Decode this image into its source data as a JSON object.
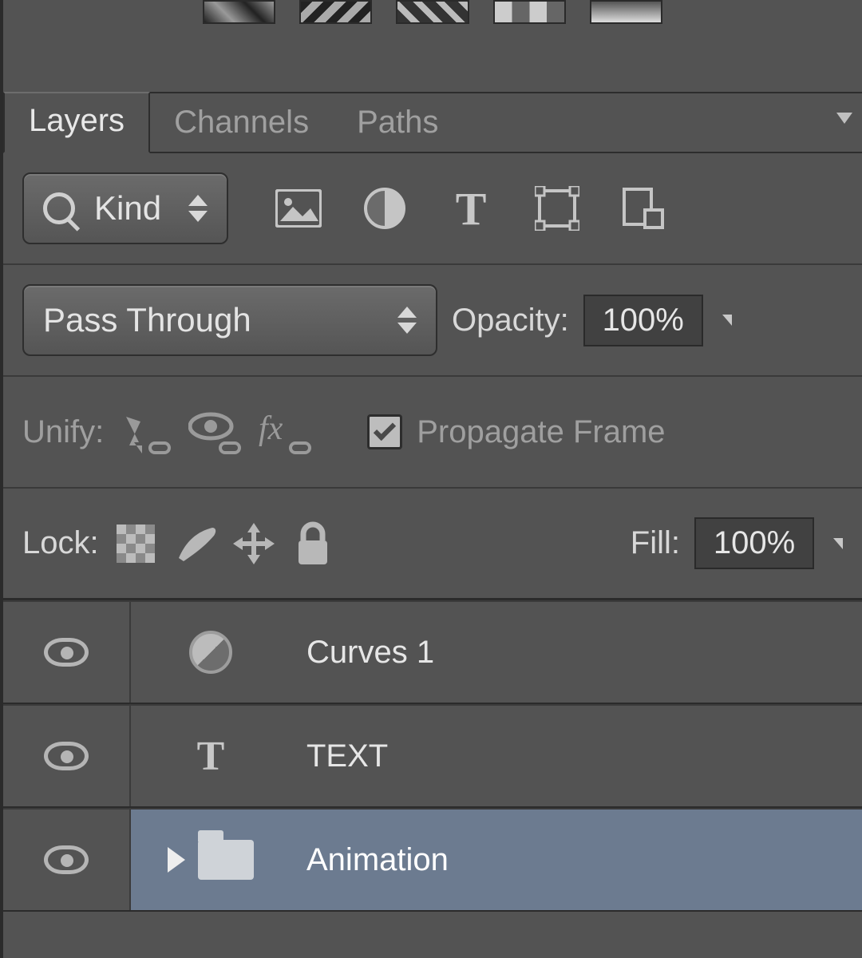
{
  "tabs": {
    "layers": "Layers",
    "channels": "Channels",
    "paths": "Paths"
  },
  "filter": {
    "kind_label": "Kind"
  },
  "blend": {
    "mode": "Pass Through",
    "opacity_label": "Opacity:",
    "opacity_value": "100%"
  },
  "unify": {
    "label": "Unify:",
    "propagate_label": "Propagate Frame"
  },
  "lock": {
    "label": "Lock:",
    "fill_label": "Fill:",
    "fill_value": "100%"
  },
  "layers": [
    {
      "name": "Curves 1",
      "type": "adjustment"
    },
    {
      "name": "TEXT",
      "type": "text"
    },
    {
      "name": "Animation",
      "type": "group",
      "selected": true
    }
  ]
}
